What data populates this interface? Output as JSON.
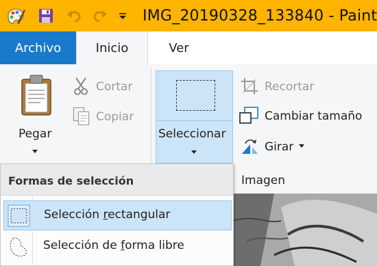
{
  "window": {
    "title": "IMG_20190328_133840 - Paint"
  },
  "quick_access": {
    "icons": [
      "paint-app-icon",
      "save-icon",
      "undo-icon",
      "redo-icon",
      "customize-quick-access-icon"
    ]
  },
  "tabs": [
    {
      "label": "Archivo"
    },
    {
      "label": "Inicio"
    },
    {
      "label": "Ver"
    }
  ],
  "ribbon": {
    "clipboard": {
      "paste_label": "Pegar",
      "cut_label": "Cortar",
      "copy_label": "Copiar"
    },
    "image": {
      "select_label": "Seleccionar",
      "crop_label": "Recortar",
      "resize_label": "Cambiar tamaño",
      "rotate_label": "Girar",
      "group_label": "Imagen"
    }
  },
  "selection_menu": {
    "title": "Formas de selección",
    "items": [
      {
        "pre": "Selección ",
        "accel": "r",
        "post": "ectangular",
        "selected": true,
        "icon": "rectangular-selection-icon"
      },
      {
        "pre": "Selección de ",
        "accel": "f",
        "post": "orma libre",
        "selected": false,
        "icon": "free-form-selection-icon"
      }
    ]
  },
  "colors": {
    "title_bar": "#ffb400",
    "file_tab": "#1979ca",
    "selection_highlight": "#cce4f7",
    "selection_border": "#99c9ef"
  }
}
